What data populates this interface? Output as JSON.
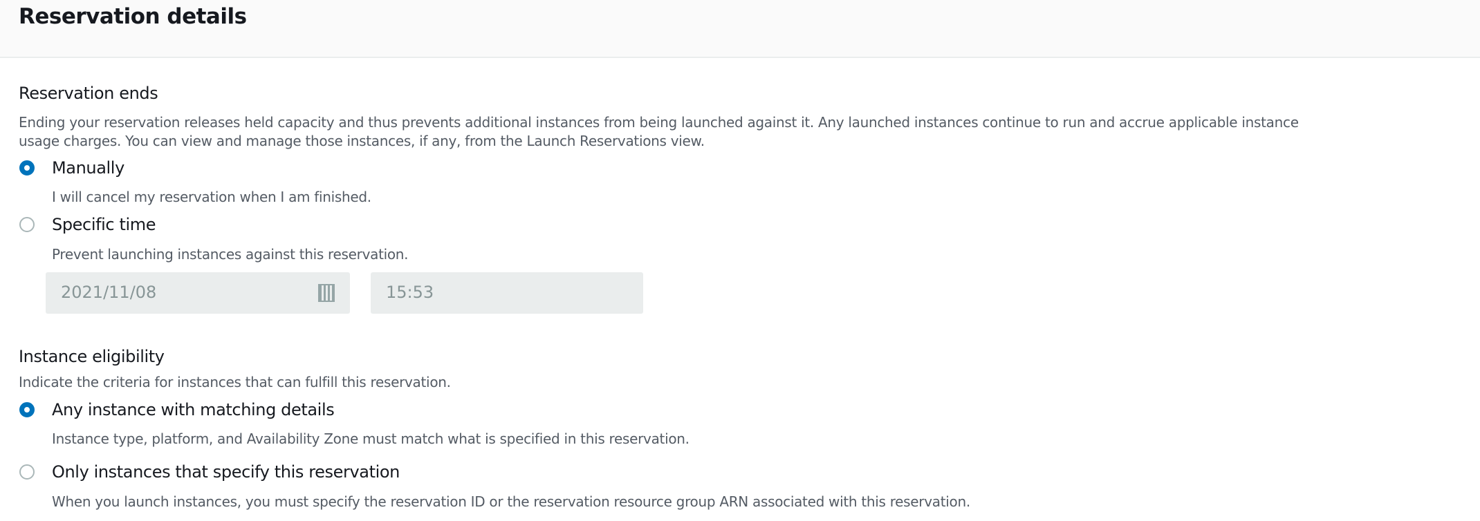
{
  "header": {
    "title": "Reservation details"
  },
  "reservation_ends": {
    "label": "Reservation ends",
    "description_line1": "Ending your reservation releases held capacity and thus prevents additional instances from being launched against it. Any launched instances continue to run and accrue applicable instance",
    "description_line2": "usage charges. You can view and manage those instances, if any, from the Launch Reservations view.",
    "options": [
      {
        "label": "Manually",
        "description": "I will cancel my reservation when I am finished.",
        "selected": true
      },
      {
        "label": "Specific time",
        "description": "Prevent launching instances against this reservation.",
        "selected": false
      }
    ],
    "date_value": "2021/11/08",
    "time_value": "15:53"
  },
  "instance_eligibility": {
    "label": "Instance eligibility",
    "description": "Indicate the criteria for instances that can fulfill this reservation.",
    "options": [
      {
        "label": "Any instance with matching details",
        "description": "Instance type, platform, and Availability Zone must match what is specified in this reservation.",
        "selected": true
      },
      {
        "label": "Only instances that specify this reservation",
        "description": "When you launch instances, you must specify the reservation ID or the reservation resource group ARN associated with this reservation.",
        "selected": false
      }
    ]
  }
}
